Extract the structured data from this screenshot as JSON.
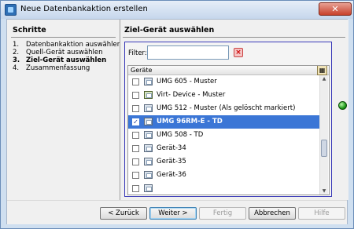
{
  "window": {
    "title": "Neue Datenbankaktion erstellen",
    "close_glyph": "✕"
  },
  "steps": {
    "title": "Schritte",
    "items": [
      {
        "num": "1.",
        "label": "Datenbankaktion auswählen",
        "current": false
      },
      {
        "num": "2.",
        "label": "Quell-Gerät auswählen",
        "current": false
      },
      {
        "num": "3.",
        "label": "Ziel-Gerät auswählen",
        "current": true
      },
      {
        "num": "4.",
        "label": "Zusammenfassung",
        "current": false
      }
    ]
  },
  "main": {
    "title": "Ziel-Gerät auswählen",
    "filter": {
      "label": "Filter:",
      "value": "",
      "placeholder": "",
      "clear_icon": "clear-filter-icon"
    },
    "table": {
      "column_header": "Geräte",
      "column_button_icon": "column-chooser-icon",
      "rows": [
        {
          "label": "UMG 605 - Muster",
          "checked": false,
          "selected": false,
          "icon": "device-icon"
        },
        {
          "label": "Virt- Device - Muster",
          "checked": false,
          "selected": false,
          "icon": "virtual-device-icon"
        },
        {
          "label": "UMG 512 - Muster  (Als gelöscht markiert)",
          "checked": false,
          "selected": false,
          "icon": "device-icon"
        },
        {
          "label": "UMG 96RM-E - TD",
          "checked": true,
          "selected": true,
          "icon": "device-icon"
        },
        {
          "label": "UMG 508 - TD",
          "checked": false,
          "selected": false,
          "icon": "device-icon"
        },
        {
          "label": "Gerät-34",
          "checked": false,
          "selected": false,
          "icon": "device-icon"
        },
        {
          "label": "Gerät-35",
          "checked": false,
          "selected": false,
          "icon": "device-icon"
        },
        {
          "label": "Gerät-36",
          "checked": false,
          "selected": false,
          "icon": "device-icon"
        },
        {
          "label": "",
          "checked": false,
          "selected": false,
          "icon": "device-icon"
        }
      ]
    },
    "status_color": "#1e9b1a"
  },
  "footer": {
    "back_label": "< Zurück",
    "next_label": "Weiter >",
    "finish_label": "Fertig",
    "cancel_label": "Abbrechen",
    "help_label": "Hilfe"
  }
}
